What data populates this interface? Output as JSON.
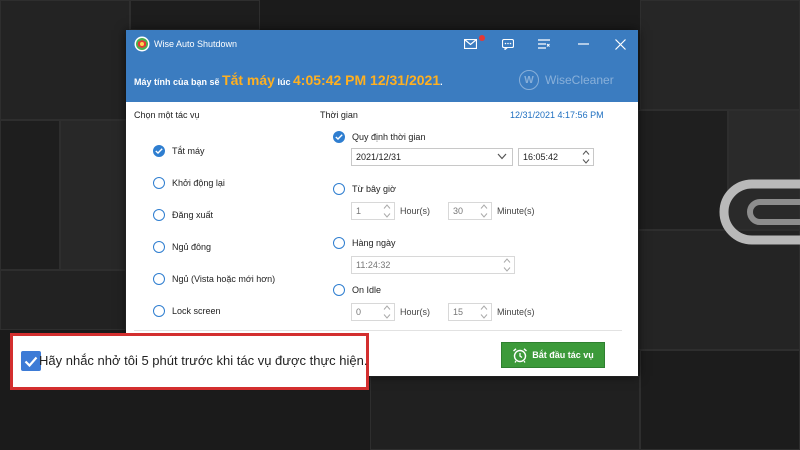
{
  "app": {
    "title": "Wise Auto Shutdown"
  },
  "header": {
    "prefix": "Máy tính của bạn sẽ",
    "action": "Tắt máy",
    "connector": "lúc",
    "scheduled_time": "4:05:42 PM 12/31/2021",
    "suffix": ".",
    "brand": "WiseCleaner",
    "brand_mark": "W"
  },
  "task_panel": {
    "heading": "Chọn một tác vụ",
    "options": [
      {
        "label": "Tắt máy",
        "selected": true
      },
      {
        "label": "Khởi động lại",
        "selected": false
      },
      {
        "label": "Đăng xuất",
        "selected": false
      },
      {
        "label": "Ngủ đông",
        "selected": false
      },
      {
        "label": "Ngủ (Vista hoặc mới hơn)",
        "selected": false
      },
      {
        "label": "Lock screen",
        "selected": false
      }
    ]
  },
  "time_panel": {
    "heading": "Thời gian",
    "current_datetime": "12/31/2021 4:17:56 PM",
    "specified": {
      "label": "Quy định thời gian",
      "selected": true,
      "date": "2021/12/31",
      "time": "16:05:42"
    },
    "from_now": {
      "label": "Từ bây giờ",
      "selected": false,
      "hours": "1",
      "hours_unit": "Hour(s)",
      "minutes": "30",
      "minutes_unit": "Minute(s)"
    },
    "daily": {
      "label": "Hàng ngày",
      "selected": false,
      "time": "11:24:32"
    },
    "on_idle": {
      "label": "On Idle",
      "selected": false,
      "hours": "0",
      "hours_unit": "Hour(s)",
      "minutes": "15",
      "minutes_unit": "Minute(s)"
    }
  },
  "start_button": {
    "label": "Bắt đầu tác vụ"
  },
  "reminder": {
    "label": "Hãy nhắc nhở tôi 5 phút trước khi tác vụ được thực hiện.",
    "checked": true
  },
  "colors": {
    "title_bar": "#3b7cc0",
    "accent_orange": "#ffb020",
    "start_green": "#3c9a3a",
    "highlight_red": "#d32f2f"
  }
}
